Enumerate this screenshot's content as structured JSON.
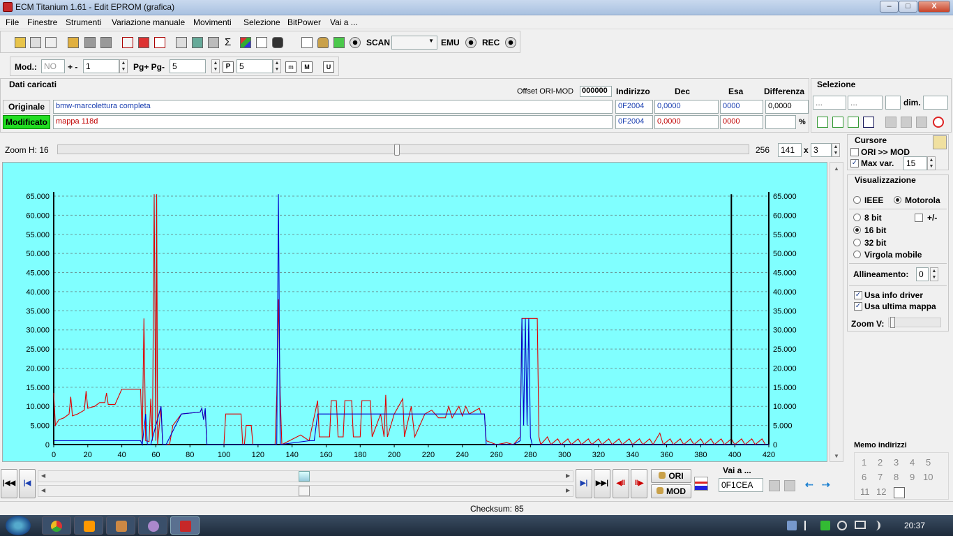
{
  "window": {
    "title": "ECM Titanium 1.61 - Edit EPROM (grafica)",
    "min": "–",
    "max": "□",
    "close": "X"
  },
  "menu": [
    "File",
    "Finestre",
    "Strumenti",
    "Variazione manuale",
    "Movimenti",
    "Selezione",
    "BitPower",
    "Vai a ..."
  ],
  "toolbar": {
    "scan": "SCAN",
    "emu": "EMU",
    "rec": "REC"
  },
  "toolbar2": {
    "mod_label": "Mod.:",
    "mod_value": "NO",
    "plusminus_label": "+ -",
    "plusminus_value": "1",
    "pg_label": "Pg+ Pg-",
    "pg_value": "5",
    "p_value": "5"
  },
  "dati": {
    "title": "Dati caricati",
    "offset_label": "Offset ORI-MOD",
    "offset_value": "000000",
    "headers": {
      "indirizzo": "Indirizzo",
      "dec": "Dec",
      "esa": "Esa",
      "diff": "Differenza"
    },
    "originale": {
      "label": "Originale",
      "file": "bmw-marcolettura completa",
      "indirizzo": "0F2004",
      "dec": "0,0000",
      "esa": "0000",
      "diff": "0,0000"
    },
    "modificato": {
      "label": "Modificato",
      "file": "mappa 118d",
      "indirizzo": "0F2004",
      "dec": "0,0000",
      "esa": "0000",
      "pct": "%"
    }
  },
  "selezione": {
    "title": "Selezione",
    "f1": "...",
    "f2": "...",
    "dim_label": "dim."
  },
  "zoom": {
    "label": "Zoom H: 16",
    "value": "256",
    "w": "141",
    "x": "x",
    "h": "3",
    "level_fraction": 0.49
  },
  "cursore": {
    "title": "Cursore",
    "ori_mod": "ORI >> MOD",
    "max_var_label": "Max var.",
    "max_var_value": "15"
  },
  "visual": {
    "title": "Visualizzazione",
    "ieee": "IEEE",
    "motorola": "Motorola",
    "b8": "8 bit",
    "pm": "+/-",
    "b16": "16 bit",
    "b32": "32 bit",
    "virgola": "Virgola mobile",
    "allin_label": "Allineamento:",
    "allin_value": "0",
    "usa_info": "Usa info driver",
    "usa_ultima": "Usa ultima mappa",
    "zoomv": "Zoom V:"
  },
  "memo": {
    "title": "Memo indirizzi",
    "items": [
      "1",
      "2",
      "3",
      "4",
      "5",
      "6",
      "7",
      "8",
      "9",
      "10",
      "11",
      "12"
    ]
  },
  "nav": {
    "ori": "ORI",
    "mod": "MOD",
    "vai_label": "Vai a ...",
    "vai_value": "0F1CEA",
    "scroll_fraction": 0.5
  },
  "status": {
    "checksum": "Checksum: 85"
  },
  "taskbar": {
    "clock": "20:37"
  },
  "chart_data": {
    "type": "line",
    "ylim": [
      0,
      65000
    ],
    "xlim": [
      0,
      420
    ],
    "y_ticks": [
      "0",
      "5.000",
      "10.000",
      "15.000",
      "20.000",
      "25.000",
      "30.000",
      "35.000",
      "40.000",
      "45.000",
      "50.000",
      "55.000",
      "60.000",
      "65.000"
    ],
    "x_ticks": [
      "0",
      "20",
      "40",
      "60",
      "80",
      "100",
      "120",
      "140",
      "160",
      "180",
      "200",
      "220",
      "240",
      "260",
      "280",
      "300",
      "320",
      "340",
      "360",
      "380",
      "400",
      "420"
    ],
    "series": [
      {
        "color": "#e00000",
        "points": [
          [
            0,
            13500
          ],
          [
            1,
            5000
          ],
          [
            3,
            6500
          ],
          [
            6,
            7000
          ],
          [
            9,
            8000
          ],
          [
            10,
            12500
          ],
          [
            11,
            7500
          ],
          [
            14,
            8000
          ],
          [
            18,
            9000
          ],
          [
            19,
            14000
          ],
          [
            20,
            9500
          ],
          [
            24,
            10000
          ],
          [
            27,
            11000
          ],
          [
            30,
            11000
          ],
          [
            31,
            13500
          ],
          [
            32,
            10500
          ],
          [
            36,
            10500
          ],
          [
            40,
            14500
          ],
          [
            51,
            14500
          ],
          [
            52,
            800
          ],
          [
            53,
            33000
          ],
          [
            54,
            1000
          ],
          [
            56,
            800
          ],
          [
            57,
            12000
          ],
          [
            58,
            1000
          ],
          [
            59,
            65500
          ],
          [
            60,
            1000
          ],
          [
            60.5,
            65500
          ],
          [
            61,
            0
          ],
          [
            63,
            10000
          ],
          [
            64,
            0
          ],
          [
            68,
            0
          ],
          [
            70,
            5000
          ],
          [
            75,
            8000
          ],
          [
            86,
            8500
          ],
          [
            87,
            9500
          ],
          [
            88,
            6500
          ],
          [
            89,
            9000
          ],
          [
            90,
            0
          ],
          [
            100,
            0
          ],
          [
            101,
            8000
          ],
          [
            110,
            8000
          ],
          [
            111,
            0
          ],
          [
            112,
            0
          ],
          [
            113,
            5000
          ],
          [
            116,
            5000
          ],
          [
            117,
            0
          ],
          [
            130,
            0
          ],
          [
            131,
            13000
          ],
          [
            132,
            38000
          ],
          [
            133,
            13000
          ],
          [
            134,
            0
          ],
          [
            145,
            2500
          ],
          [
            150,
            1000
          ],
          [
            155,
            11500
          ],
          [
            156,
            2000
          ],
          [
            162,
            2000
          ],
          [
            163,
            11500
          ],
          [
            166,
            11500
          ],
          [
            167,
            2000
          ],
          [
            170,
            2000
          ],
          [
            171,
            11500
          ],
          [
            175,
            11500
          ],
          [
            176,
            2000
          ],
          [
            180,
            2000
          ],
          [
            181,
            11500
          ],
          [
            186,
            11500
          ],
          [
            187,
            2000
          ],
          [
            192,
            8000
          ],
          [
            194,
            2000
          ],
          [
            195,
            13000
          ],
          [
            196,
            2000
          ],
          [
            200,
            8000
          ],
          [
            205,
            12000
          ],
          [
            206,
            2000
          ],
          [
            210,
            10000
          ],
          [
            212,
            2000
          ],
          [
            218,
            8000
          ],
          [
            222,
            9000
          ],
          [
            226,
            7000
          ],
          [
            230,
            7000
          ],
          [
            232,
            10000
          ],
          [
            234,
            7000
          ],
          [
            238,
            10000
          ],
          [
            240,
            7500
          ],
          [
            242,
            10000
          ],
          [
            244,
            8000
          ],
          [
            250,
            9500
          ],
          [
            251,
            8000
          ],
          [
            253,
            8000
          ],
          [
            254,
            1000
          ],
          [
            260,
            0
          ],
          [
            266,
            500
          ],
          [
            270,
            0
          ],
          [
            274,
            2000
          ],
          [
            275,
            33000
          ],
          [
            284,
            33000
          ],
          [
            285,
            2000
          ],
          [
            286,
            0
          ],
          [
            290,
            2000
          ],
          [
            292,
            0
          ],
          [
            296,
            1500
          ],
          [
            298,
            0
          ],
          [
            302,
            1500
          ],
          [
            304,
            0
          ],
          [
            308,
            1500
          ],
          [
            310,
            0
          ],
          [
            314,
            1500
          ],
          [
            316,
            0
          ],
          [
            320,
            1500
          ],
          [
            322,
            0
          ],
          [
            326,
            1500
          ],
          [
            328,
            0
          ],
          [
            332,
            1500
          ],
          [
            334,
            0
          ],
          [
            338,
            1500
          ],
          [
            340,
            0
          ],
          [
            344,
            1500
          ],
          [
            346,
            0
          ],
          [
            350,
            1500
          ],
          [
            352,
            0
          ],
          [
            356,
            3000
          ],
          [
            358,
            0
          ],
          [
            362,
            1500
          ],
          [
            364,
            0
          ],
          [
            368,
            1500
          ],
          [
            370,
            0
          ],
          [
            374,
            1500
          ],
          [
            376,
            0
          ],
          [
            380,
            1500
          ],
          [
            382,
            0
          ],
          [
            386,
            1500
          ],
          [
            388,
            0
          ],
          [
            392,
            1500
          ],
          [
            394,
            0
          ],
          [
            398,
            1500
          ],
          [
            400,
            0
          ],
          [
            404,
            1500
          ],
          [
            406,
            0
          ],
          [
            410,
            1500
          ],
          [
            412,
            0
          ],
          [
            416,
            1500
          ],
          [
            418,
            0
          ],
          [
            420,
            0
          ]
        ]
      },
      {
        "color": "#0000cc",
        "points": [
          [
            0,
            1000
          ],
          [
            51,
            1000
          ],
          [
            52,
            0
          ],
          [
            54,
            8000
          ],
          [
            55,
            0
          ],
          [
            56,
            0
          ],
          [
            57,
            0
          ],
          [
            63,
            10000
          ],
          [
            64,
            0
          ],
          [
            66,
            0
          ],
          [
            75,
            8000
          ],
          [
            86,
            8500
          ],
          [
            87,
            9500
          ],
          [
            88,
            6500
          ],
          [
            89,
            9500
          ],
          [
            90,
            0
          ],
          [
            131,
            0
          ],
          [
            132,
            65500
          ],
          [
            133,
            0
          ],
          [
            150,
            1000
          ],
          [
            153,
            1000
          ],
          [
            155,
            8000
          ],
          [
            253,
            8000
          ],
          [
            254,
            0
          ],
          [
            270,
            0
          ],
          [
            274,
            1000
          ],
          [
            275,
            33000
          ],
          [
            276,
            5000
          ],
          [
            277,
            33000
          ],
          [
            278,
            5000
          ],
          [
            279,
            33000
          ],
          [
            280,
            2000
          ],
          [
            281,
            0
          ],
          [
            420,
            0
          ]
        ]
      },
      {
        "color": "#000000",
        "points": [
          [
            398,
            0
          ],
          [
            398,
            65500
          ]
        ]
      }
    ]
  }
}
